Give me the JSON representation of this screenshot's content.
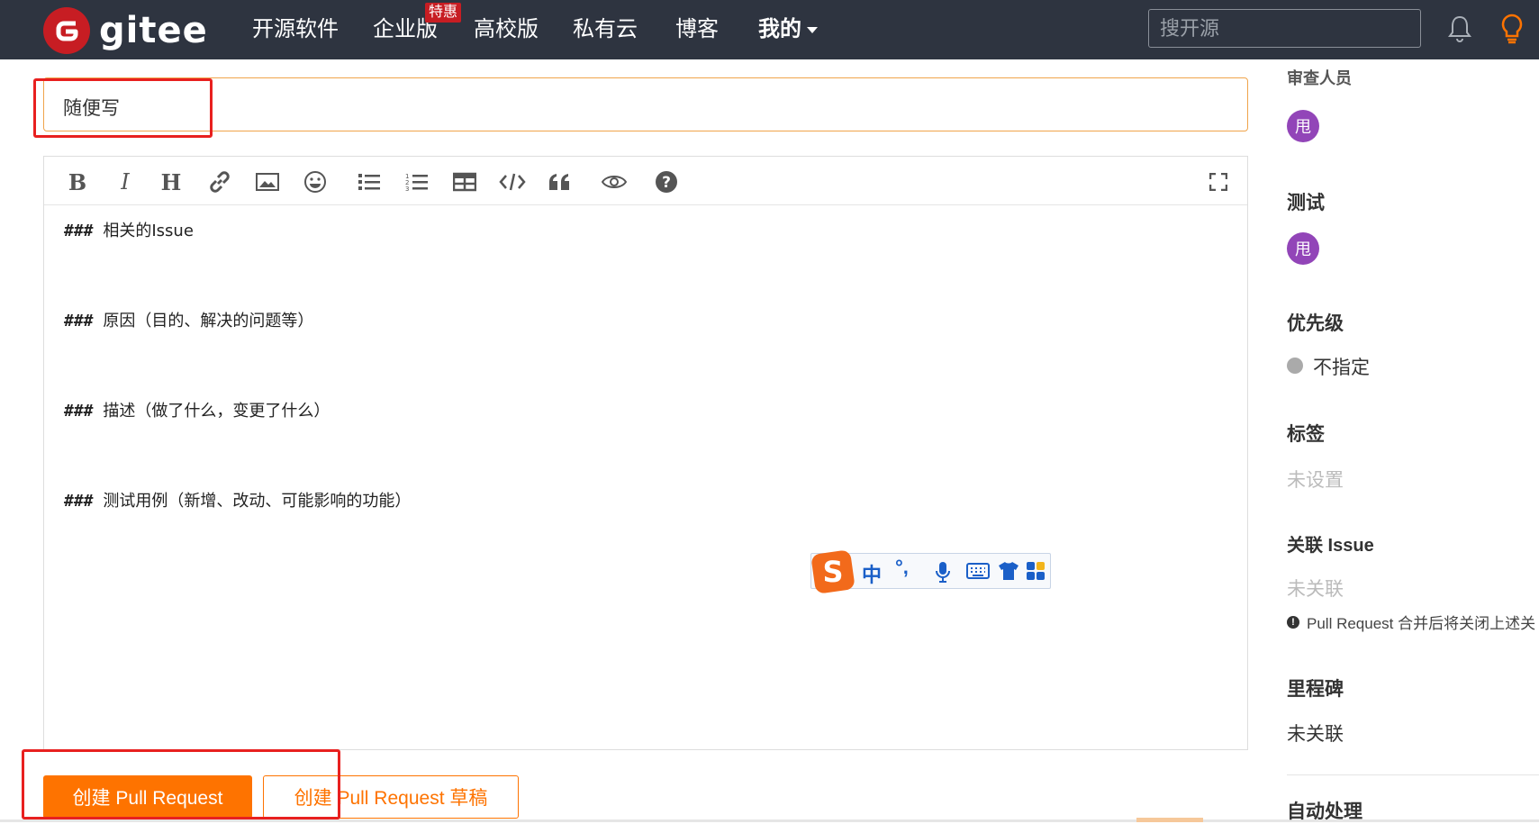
{
  "nav": {
    "brand": "gitee",
    "items": [
      "开源软件",
      "企业版",
      "高校版",
      "私有云",
      "博客"
    ],
    "badge": "特惠",
    "mine": "我的",
    "search_placeholder": "搜开源"
  },
  "form": {
    "title_value": "随便写",
    "toolbar": [
      "bold-icon",
      "italic-icon",
      "heading-icon",
      "link-icon",
      "image-icon",
      "emoji-icon",
      "unordered-list-icon",
      "ordered-list-icon",
      "table-icon",
      "code-icon",
      "quote-icon",
      "preview-icon",
      "help-icon",
      "fullscreen-icon"
    ],
    "lines": [
      {
        "hash": "###",
        "text": "相关的Issue"
      },
      {
        "hash": "###",
        "text": "原因（目的、解决的问题等）"
      },
      {
        "hash": "###",
        "text": "描述（做了什么，变更了什么）"
      },
      {
        "hash": "###",
        "text": "测试用例（新增、改动、可能影响的功能）"
      }
    ],
    "submit_label": "创建 Pull Request",
    "draft_label": "创建 Pull Request 草稿"
  },
  "ime": {
    "mode": "中",
    "punct": "°,"
  },
  "sidebar": {
    "reviewers_title": "审查人员",
    "reviewer_avatar": "甩",
    "testers_title": "测试",
    "tester_avatar": "甩",
    "priority_title": "优先级",
    "priority_value": "不指定",
    "labels_title": "标签",
    "labels_value": "未设置",
    "issue_title": "关联 Issue",
    "issue_value": "未关联",
    "issue_hint": "Pull Request 合并后将关闭上述关",
    "milestone_title": "里程碑",
    "milestone_value": "未关联",
    "auto_title": "自动处理"
  },
  "colors": {
    "nav_bg": "#2e3440",
    "brand_red": "#c71d23",
    "accent_orange": "#fe7300",
    "avatar_purple": "#9245b8",
    "annotation_red": "#e8201f"
  }
}
